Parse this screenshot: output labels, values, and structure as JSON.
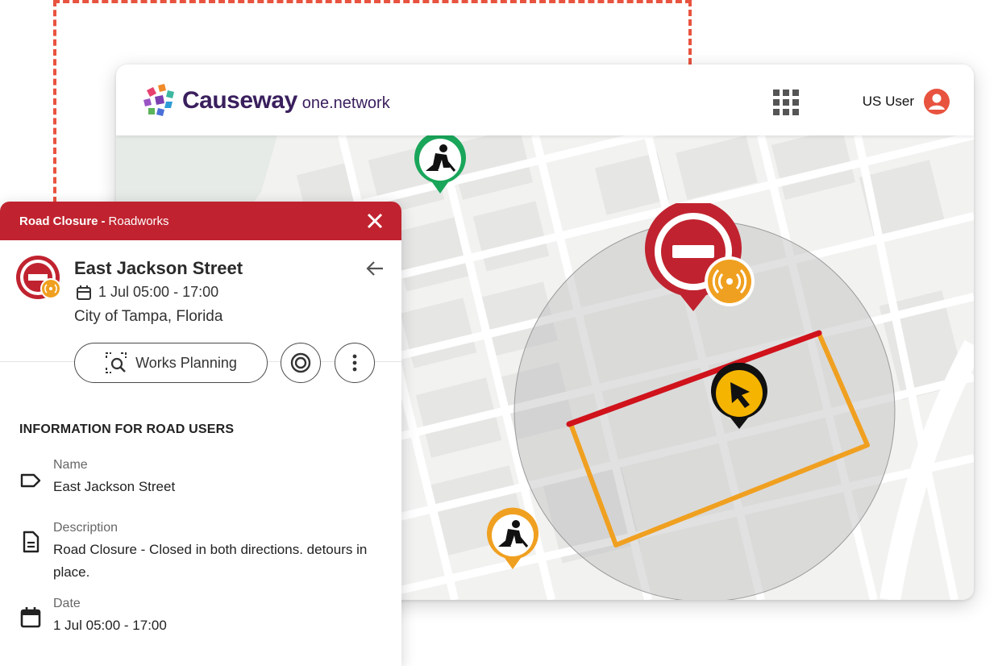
{
  "brand": {
    "name": "Causeway",
    "sub": "one.network"
  },
  "header": {
    "user_name": "US User"
  },
  "panel": {
    "type": "Road Closure",
    "separator": "-",
    "subtype": "Roadworks",
    "title": "East Jackson Street",
    "date": "1 Jul 05:00 - 17:00",
    "location": "City of Tampa, Florida",
    "works_button": "Works Planning",
    "info_heading": "INFORMATION FOR ROAD USERS",
    "fields": [
      {
        "label": "Name",
        "value": "East Jackson Street",
        "icon": "tag-icon"
      },
      {
        "label": "Description",
        "value": "Road Closure - Closed in both directions. detours in place.",
        "icon": "document-icon"
      },
      {
        "label": "Date",
        "value": "1 Jul 05:00 - 17:00",
        "icon": "calendar-icon"
      }
    ]
  },
  "colors": {
    "closure_red": "#c0232f",
    "diversion_orange": "#f0a020",
    "roadworks_green": "#1aa65a",
    "highlight_dash": "#e8533f",
    "brand_purple": "#3a1f5d"
  }
}
